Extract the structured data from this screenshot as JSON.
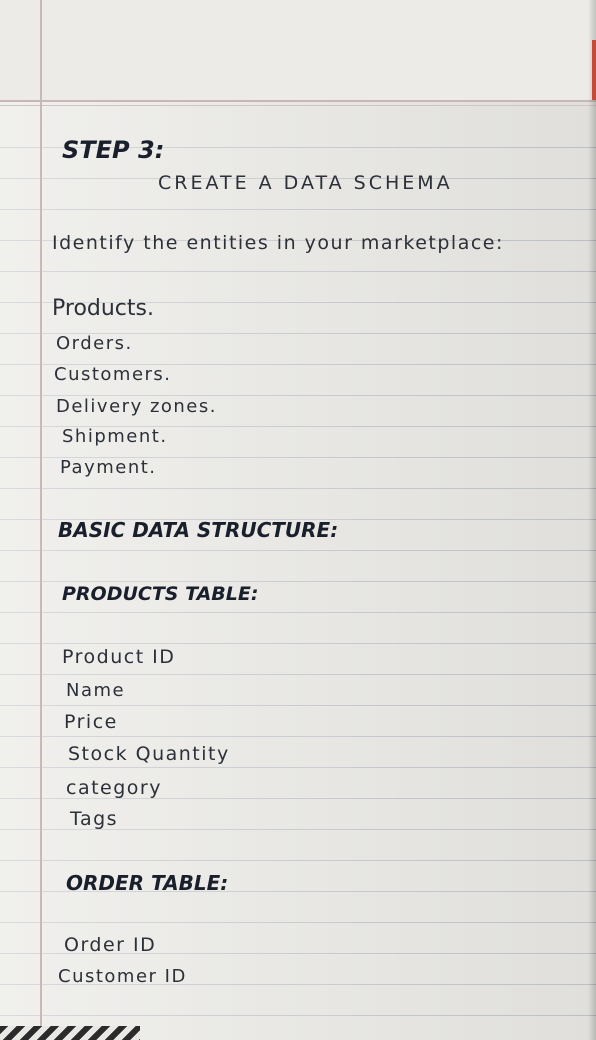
{
  "step": {
    "heading": "STEP 3:",
    "subtitle": "CREATE A DATA SCHEMA"
  },
  "intro": "Identify the entities in your marketplace:",
  "entities": [
    "Products.",
    "Orders.",
    "Customers.",
    "Delivery zones.",
    "Shipment.",
    "Payment."
  ],
  "basic_heading": "BASIC DATA STRUCTURE:",
  "products_table": {
    "heading": "PRODUCTS TABLE:",
    "fields": [
      "Product ID",
      "Name",
      "Price",
      "Stock Quantity",
      "category",
      "Tags"
    ]
  },
  "order_table": {
    "heading": "ORDER TABLE:",
    "fields": [
      "Order ID",
      "Customer ID"
    ]
  }
}
